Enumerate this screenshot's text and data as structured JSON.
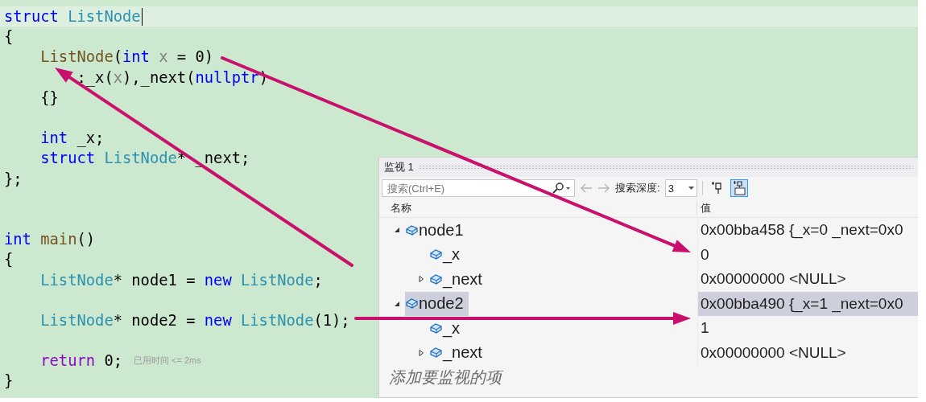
{
  "editor": {
    "lines": [
      {
        "current": true,
        "tokens": [
          {
            "kind": "kw",
            "text": "struct"
          },
          {
            "kind": "type",
            "text": " ListNode"
          }
        ]
      },
      {
        "tokens": [
          {
            "kind": "plain",
            "text": "{"
          }
        ]
      },
      {
        "tokens": [
          {
            "kind": "fn",
            "text": "    ListNode"
          },
          {
            "kind": "plain",
            "text": "("
          },
          {
            "kind": "kw",
            "text": "int"
          },
          {
            "kind": "param",
            "text": " x"
          },
          {
            "kind": "plain",
            "text": " = 0)"
          }
        ]
      },
      {
        "tokens": [
          {
            "kind": "plain",
            "text": "        :_x("
          },
          {
            "kind": "param",
            "text": "x"
          },
          {
            "kind": "plain",
            "text": "),_next("
          },
          {
            "kind": "kw",
            "text": "nullptr"
          },
          {
            "kind": "plain",
            "text": ")"
          }
        ]
      },
      {
        "tokens": [
          {
            "kind": "plain",
            "text": "    {}"
          }
        ]
      },
      {
        "kind": "blank"
      },
      {
        "tokens": [
          {
            "kind": "kw",
            "text": "    int"
          },
          {
            "kind": "plain",
            "text": " _x;"
          }
        ]
      },
      {
        "tokens": [
          {
            "kind": "kw",
            "text": "    struct"
          },
          {
            "kind": "type",
            "text": " ListNode"
          },
          {
            "kind": "plain",
            "text": "* _next;"
          }
        ]
      },
      {
        "tokens": [
          {
            "kind": "plain",
            "text": "};"
          }
        ]
      },
      {
        "kind": "blank"
      },
      {
        "kind": "blank"
      },
      {
        "tokens": [
          {
            "kind": "kw",
            "text": "int"
          },
          {
            "kind": "fn",
            "text": " main"
          },
          {
            "kind": "plain",
            "text": "()"
          }
        ]
      },
      {
        "tokens": [
          {
            "kind": "plain",
            "text": "{"
          }
        ]
      },
      {
        "tokens": [
          {
            "kind": "type",
            "text": "    ListNode"
          },
          {
            "kind": "plain",
            "text": "* node1 = "
          },
          {
            "kind": "kw",
            "text": "new"
          },
          {
            "kind": "type",
            "text": " ListNode"
          },
          {
            "kind": "plain",
            "text": ";"
          }
        ]
      },
      {
        "kind": "blank"
      },
      {
        "tokens": [
          {
            "kind": "type",
            "text": "    ListNode"
          },
          {
            "kind": "plain",
            "text": "* node2 = "
          },
          {
            "kind": "kw",
            "text": "new"
          },
          {
            "kind": "type",
            "text": " ListNode"
          },
          {
            "kind": "plain",
            "text": "(1);"
          }
        ]
      },
      {
        "kind": "blank"
      },
      {
        "hint": "已用时间 <= 2ms",
        "tokens": [
          {
            "kind": "ctl",
            "text": "    return"
          },
          {
            "kind": "plain",
            "text": " 0;"
          }
        ]
      },
      {
        "tokens": [
          {
            "kind": "plain",
            "text": "}"
          }
        ]
      }
    ]
  },
  "watch": {
    "title": "监视 1",
    "search": {
      "placeholder": "搜索(Ctrl+E)"
    },
    "depth_label": "搜索深度:",
    "depth": "3",
    "ab_toggle": {
      "on": true
    },
    "columns": [
      "名称",
      "值"
    ],
    "items": [
      {
        "name": "node1",
        "value": "0x00bba458 {_x=0 _next=0x0",
        "expanded": true,
        "selected": false,
        "children": [
          {
            "name": "_x",
            "value": "0",
            "selected": false
          },
          {
            "name": "_next",
            "value": "0x00000000 <NULL>",
            "expanded": false,
            "selected": false
          }
        ]
      },
      {
        "name": "node2",
        "value": "0x00bba490 {_x=1 _next=0x0",
        "expanded": true,
        "selected": true,
        "children": [
          {
            "name": "_x",
            "value": "1",
            "selected": false
          },
          {
            "name": "_next",
            "value": "0x00000000 <NULL>",
            "expanded": false,
            "selected": false
          }
        ]
      }
    ],
    "add_hint": "添加要监视的项"
  }
}
